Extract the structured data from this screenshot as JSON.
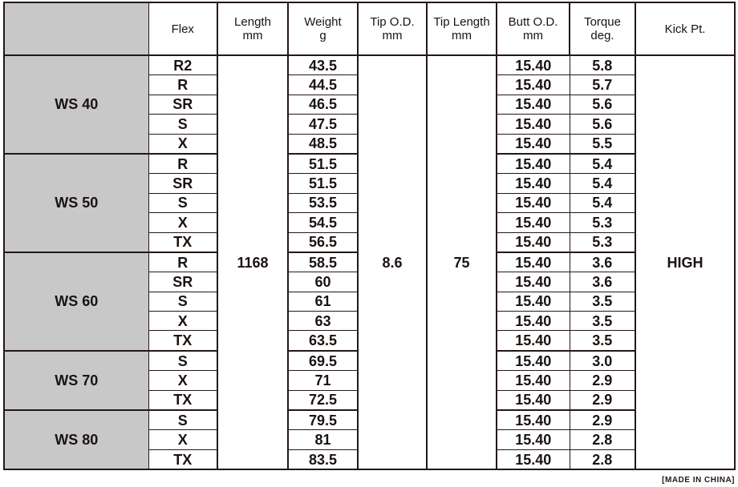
{
  "table": {
    "headers": {
      "model": "",
      "flex": "Flex",
      "length": [
        "Length",
        "mm"
      ],
      "weight": [
        "Weight",
        "g"
      ],
      "tip_od": [
        "Tip O.D.",
        "mm"
      ],
      "tip_length": [
        "Tip Length",
        "mm"
      ],
      "butt_od": [
        "Butt O.D.",
        "mm"
      ],
      "torque": [
        "Torque",
        "deg."
      ],
      "kick": "Kick Pt."
    },
    "shared": {
      "length": "1168",
      "tip_od": "8.6",
      "tip_length": "75",
      "kick": "HIGH"
    },
    "groups": [
      {
        "model": "WS 40",
        "rows": [
          {
            "flex": "R2",
            "weight": "43.5",
            "butt_od": "15.40",
            "torque": "5.8"
          },
          {
            "flex": "R",
            "weight": "44.5",
            "butt_od": "15.40",
            "torque": "5.7"
          },
          {
            "flex": "SR",
            "weight": "46.5",
            "butt_od": "15.40",
            "torque": "5.6"
          },
          {
            "flex": "S",
            "weight": "47.5",
            "butt_od": "15.40",
            "torque": "5.6"
          },
          {
            "flex": "X",
            "weight": "48.5",
            "butt_od": "15.40",
            "torque": "5.5"
          }
        ]
      },
      {
        "model": "WS 50",
        "rows": [
          {
            "flex": "R",
            "weight": "51.5",
            "butt_od": "15.40",
            "torque": "5.4"
          },
          {
            "flex": "SR",
            "weight": "51.5",
            "butt_od": "15.40",
            "torque": "5.4"
          },
          {
            "flex": "S",
            "weight": "53.5",
            "butt_od": "15.40",
            "torque": "5.4"
          },
          {
            "flex": "X",
            "weight": "54.5",
            "butt_od": "15.40",
            "torque": "5.3"
          },
          {
            "flex": "TX",
            "weight": "56.5",
            "butt_od": "15.40",
            "torque": "5.3"
          }
        ]
      },
      {
        "model": "WS 60",
        "rows": [
          {
            "flex": "R",
            "weight": "58.5",
            "butt_od": "15.40",
            "torque": "3.6"
          },
          {
            "flex": "SR",
            "weight": "60",
            "butt_od": "15.40",
            "torque": "3.6"
          },
          {
            "flex": "S",
            "weight": "61",
            "butt_od": "15.40",
            "torque": "3.5"
          },
          {
            "flex": "X",
            "weight": "63",
            "butt_od": "15.40",
            "torque": "3.5"
          },
          {
            "flex": "TX",
            "weight": "63.5",
            "butt_od": "15.40",
            "torque": "3.5"
          }
        ]
      },
      {
        "model": "WS 70",
        "rows": [
          {
            "flex": "S",
            "weight": "69.5",
            "butt_od": "15.40",
            "torque": "3.0"
          },
          {
            "flex": "X",
            "weight": "71",
            "butt_od": "15.40",
            "torque": "2.9"
          },
          {
            "flex": "TX",
            "weight": "72.5",
            "butt_od": "15.40",
            "torque": "2.9"
          }
        ]
      },
      {
        "model": "WS 80",
        "rows": [
          {
            "flex": "S",
            "weight": "79.5",
            "butt_od": "15.40",
            "torque": "2.9"
          },
          {
            "flex": "X",
            "weight": "81",
            "butt_od": "15.40",
            "torque": "2.8"
          },
          {
            "flex": "TX",
            "weight": "83.5",
            "butt_od": "15.40",
            "torque": "2.8"
          }
        ]
      }
    ]
  },
  "footnote": "[MADE IN CHINA]"
}
